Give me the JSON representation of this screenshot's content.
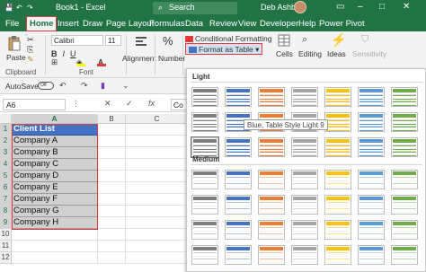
{
  "titlebar": {
    "document": "Book1 - Excel",
    "search_placeholder": "Search",
    "user": "Deb Ashby",
    "minimize": "–",
    "restore": "□",
    "close": "✕",
    "autosave_icon": "save-icon"
  },
  "tabs": [
    "Home",
    "Insert",
    "Draw",
    "Page Layout",
    "Formulas",
    "Data",
    "Review",
    "View",
    "Developer",
    "Help",
    "Power Pivot"
  ],
  "file_tab": "File",
  "ribbon": {
    "paste": "Paste",
    "clipboard": "Clipboard",
    "font_name": "Calibri",
    "font_size": "11",
    "bold": "B",
    "italic": "I",
    "underline": "U",
    "font_group": "Font",
    "alignment": "Alignment",
    "number": "Number",
    "conditional_formatting": "Conditional Formatting",
    "format_as_table": "Format as Table",
    "cells": "Cells",
    "editing": "Editing",
    "ideas": "Ideas",
    "sensitivity": "Sensitivity",
    "colors": {
      "font_color": "#e03a3a",
      "fill_color": "#ffff00"
    }
  },
  "quick_access": {
    "autosave_label": "AutoSave",
    "autosave_state": "Off"
  },
  "formula_bar": {
    "name_box": "A6",
    "formula_text": "Co",
    "fx": "fx",
    "cancel": "✕",
    "enter": "✓"
  },
  "grid": {
    "columns": [
      "A",
      "B",
      "C"
    ],
    "rows": [
      "1",
      "2",
      "3",
      "4",
      "5",
      "6",
      "7",
      "8",
      "9",
      "10",
      "11",
      "12"
    ],
    "header_cell": "Client List",
    "companies": [
      "Company A",
      "Company B",
      "Company C",
      "Company D",
      "Company E",
      "Company F",
      "Company G",
      "Company H"
    ]
  },
  "gallery": {
    "light_label": "Light",
    "medium_label": "Medium",
    "tooltip": "Blue, Table Style Light 9",
    "light_colors": [
      "#7f7f7f",
      "#4472c4",
      "#ed7d31",
      "#a5a5a5",
      "#ffc000",
      "#5b9bd5",
      "#70ad47"
    ],
    "medium_colors": [
      "#7f7f7f",
      "#4472c4",
      "#ed7d31",
      "#a5a5a5",
      "#ffc000",
      "#5b9bd5",
      "#70ad47"
    ]
  }
}
